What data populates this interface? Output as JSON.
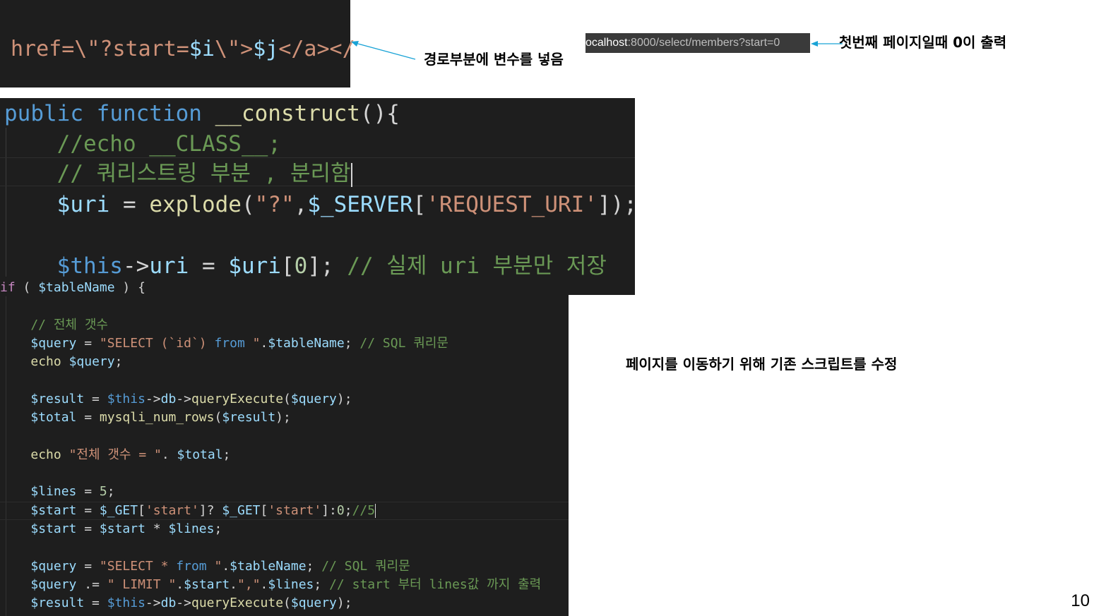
{
  "panel1": {
    "line": [
      {
        "t": "href=\\\"?start=",
        "c": "str"
      },
      {
        "t": "$i",
        "c": "var"
      },
      {
        "t": "\\\">",
        "c": "str"
      },
      {
        "t": "$j",
        "c": "var"
      },
      {
        "t": "</a></",
        "c": "str"
      }
    ]
  },
  "panel2": {
    "lines": [
      [
        {
          "t": "public ",
          "c": "kw"
        },
        {
          "t": "function ",
          "c": "kw"
        },
        {
          "t": "__construct",
          "c": "fn"
        },
        {
          "t": "(){",
          "c": "pl"
        }
      ],
      [
        {
          "t": "    //echo __CLASS__;",
          "c": "cm"
        }
      ],
      [
        {
          "t": "    // 쿼리스트링 부분 , 분리함",
          "c": "cm"
        }
      ],
      [
        {
          "t": "    ",
          "c": "pl"
        },
        {
          "t": "$uri",
          "c": "var"
        },
        {
          "t": " = ",
          "c": "pl"
        },
        {
          "t": "explode",
          "c": "fn"
        },
        {
          "t": "(",
          "c": "pl"
        },
        {
          "t": "\"?\"",
          "c": "str"
        },
        {
          "t": ",",
          "c": "pl"
        },
        {
          "t": "$_SERVER",
          "c": "var"
        },
        {
          "t": "[",
          "c": "pl"
        },
        {
          "t": "'REQUEST_URI'",
          "c": "str"
        },
        {
          "t": "]);",
          "c": "pl"
        }
      ],
      [],
      [
        {
          "t": "    ",
          "c": "pl"
        },
        {
          "t": "$this",
          "c": "kw"
        },
        {
          "t": "->",
          "c": "pl"
        },
        {
          "t": "uri",
          "c": "var"
        },
        {
          "t": " = ",
          "c": "pl"
        },
        {
          "t": "$uri",
          "c": "var"
        },
        {
          "t": "[",
          "c": "pl"
        },
        {
          "t": "0",
          "c": "num"
        },
        {
          "t": "]; ",
          "c": "pl"
        },
        {
          "t": "// 실제 uri 부분만 저장",
          "c": "cm"
        }
      ]
    ]
  },
  "panel3": {
    "lines": [
      [
        {
          "t": "if",
          "c": "ctl"
        },
        {
          "t": " ( ",
          "c": "pl"
        },
        {
          "t": "$tableName",
          "c": "var"
        },
        {
          "t": " ) {",
          "c": "pl"
        }
      ],
      [],
      [
        {
          "t": "    // 전체 갯수",
          "c": "cm"
        }
      ],
      [
        {
          "t": "    ",
          "c": "pl"
        },
        {
          "t": "$query",
          "c": "var"
        },
        {
          "t": " = ",
          "c": "pl"
        },
        {
          "t": "\"SELECT (`id`) ",
          "c": "str"
        },
        {
          "t": "from",
          "c": "kw"
        },
        {
          "t": " \"",
          "c": "str"
        },
        {
          "t": ".",
          "c": "pl"
        },
        {
          "t": "$tableName",
          "c": "var"
        },
        {
          "t": "; ",
          "c": "pl"
        },
        {
          "t": "// SQL 쿼리문",
          "c": "cm"
        }
      ],
      [
        {
          "t": "    ",
          "c": "pl"
        },
        {
          "t": "echo",
          "c": "fn"
        },
        {
          "t": " ",
          "c": "pl"
        },
        {
          "t": "$query",
          "c": "var"
        },
        {
          "t": ";",
          "c": "pl"
        }
      ],
      [],
      [
        {
          "t": "    ",
          "c": "pl"
        },
        {
          "t": "$result",
          "c": "var"
        },
        {
          "t": " = ",
          "c": "pl"
        },
        {
          "t": "$this",
          "c": "kw"
        },
        {
          "t": "->",
          "c": "pl"
        },
        {
          "t": "db",
          "c": "var"
        },
        {
          "t": "->",
          "c": "pl"
        },
        {
          "t": "queryExecute",
          "c": "fn"
        },
        {
          "t": "(",
          "c": "pl"
        },
        {
          "t": "$query",
          "c": "var"
        },
        {
          "t": ");",
          "c": "pl"
        }
      ],
      [
        {
          "t": "    ",
          "c": "pl"
        },
        {
          "t": "$total",
          "c": "var"
        },
        {
          "t": " = ",
          "c": "pl"
        },
        {
          "t": "mysqli_num_rows",
          "c": "fn"
        },
        {
          "t": "(",
          "c": "pl"
        },
        {
          "t": "$result",
          "c": "var"
        },
        {
          "t": ");",
          "c": "pl"
        }
      ],
      [],
      [
        {
          "t": "    ",
          "c": "pl"
        },
        {
          "t": "echo",
          "c": "fn"
        },
        {
          "t": " ",
          "c": "pl"
        },
        {
          "t": "\"전체 갯수 = \"",
          "c": "str"
        },
        {
          "t": ". ",
          "c": "pl"
        },
        {
          "t": "$total",
          "c": "var"
        },
        {
          "t": ";",
          "c": "pl"
        }
      ],
      [],
      [
        {
          "t": "    ",
          "c": "pl"
        },
        {
          "t": "$lines",
          "c": "var"
        },
        {
          "t": " = ",
          "c": "pl"
        },
        {
          "t": "5",
          "c": "num"
        },
        {
          "t": ";",
          "c": "pl"
        }
      ],
      [
        {
          "t": "    ",
          "c": "pl"
        },
        {
          "t": "$start",
          "c": "var"
        },
        {
          "t": " = ",
          "c": "pl"
        },
        {
          "t": "$_GET",
          "c": "var"
        },
        {
          "t": "[",
          "c": "pl"
        },
        {
          "t": "'start'",
          "c": "str"
        },
        {
          "t": "]? ",
          "c": "pl"
        },
        {
          "t": "$_GET",
          "c": "var"
        },
        {
          "t": "[",
          "c": "pl"
        },
        {
          "t": "'start'",
          "c": "str"
        },
        {
          "t": "]:",
          "c": "pl"
        },
        {
          "t": "0",
          "c": "num"
        },
        {
          "t": ";",
          "c": "pl"
        },
        {
          "t": "//5",
          "c": "cm"
        }
      ],
      [
        {
          "t": "    ",
          "c": "pl"
        },
        {
          "t": "$start",
          "c": "var"
        },
        {
          "t": " = ",
          "c": "pl"
        },
        {
          "t": "$start",
          "c": "var"
        },
        {
          "t": " * ",
          "c": "pl"
        },
        {
          "t": "$lines",
          "c": "var"
        },
        {
          "t": ";",
          "c": "pl"
        }
      ],
      [],
      [
        {
          "t": "    ",
          "c": "pl"
        },
        {
          "t": "$query",
          "c": "var"
        },
        {
          "t": " = ",
          "c": "pl"
        },
        {
          "t": "\"SELECT * ",
          "c": "str"
        },
        {
          "t": "from",
          "c": "kw"
        },
        {
          "t": " \"",
          "c": "str"
        },
        {
          "t": ".",
          "c": "pl"
        },
        {
          "t": "$tableName",
          "c": "var"
        },
        {
          "t": "; ",
          "c": "pl"
        },
        {
          "t": "// SQL 쿼리문",
          "c": "cm"
        }
      ],
      [
        {
          "t": "    ",
          "c": "pl"
        },
        {
          "t": "$query",
          "c": "var"
        },
        {
          "t": " .= ",
          "c": "pl"
        },
        {
          "t": "\" LIMIT \"",
          "c": "str"
        },
        {
          "t": ".",
          "c": "pl"
        },
        {
          "t": "$start",
          "c": "var"
        },
        {
          "t": ".",
          "c": "pl"
        },
        {
          "t": "\",\"",
          "c": "str"
        },
        {
          "t": ".",
          "c": "pl"
        },
        {
          "t": "$lines",
          "c": "var"
        },
        {
          "t": "; ",
          "c": "pl"
        },
        {
          "t": "// start 부터 lines값 까지 출력",
          "c": "cm"
        }
      ],
      [
        {
          "t": "    ",
          "c": "pl"
        },
        {
          "t": "$result",
          "c": "var"
        },
        {
          "t": " = ",
          "c": "pl"
        },
        {
          "t": "$this",
          "c": "kw"
        },
        {
          "t": "->",
          "c": "pl"
        },
        {
          "t": "db",
          "c": "var"
        },
        {
          "t": "->",
          "c": "pl"
        },
        {
          "t": "queryExecute",
          "c": "fn"
        },
        {
          "t": "(",
          "c": "pl"
        },
        {
          "t": "$query",
          "c": "var"
        },
        {
          "t": ");",
          "c": "pl"
        }
      ]
    ]
  },
  "urlbar": {
    "host": "ocalhost",
    "path": ":8000/select/members?start=0"
  },
  "annotations": {
    "path_variable": "경로부분에 변수를 넣음",
    "first_page": "첫번째 페이지일때 0이 출력",
    "modify_script": "페이지를 이동하기 위해 기존 스크립트를 수정"
  },
  "slide_number": "10",
  "colors": {
    "editor_bg": "#1e1e1e",
    "arrow": "#1aa3d6"
  }
}
